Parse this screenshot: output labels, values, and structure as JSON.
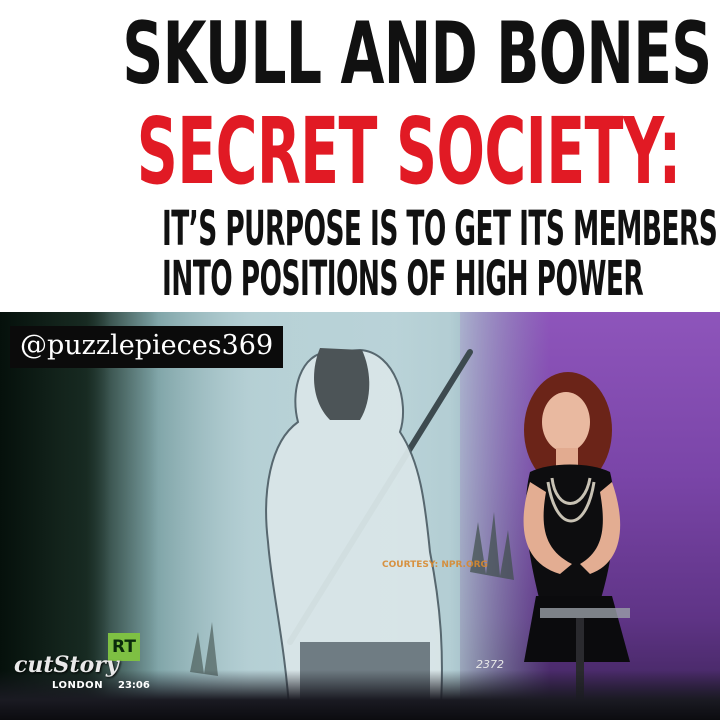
{
  "headline": {
    "line1": "SKULL AND BONES",
    "line2": "SECRET SOCIETY:",
    "line3": "IT’S PURPOSE IS TO GET ITS MEMBERS",
    "line4": "INTO POSITIONS OF HIGH POWER",
    "line1_color": "#111111",
    "line2_color": "#e11a24"
  },
  "video": {
    "handle": "@puzzlepieces369",
    "channel_logo": "RT",
    "show_logo": "cutStory",
    "location": "LONDON",
    "time": "23:06",
    "photo_credit": "COURTESY: NPR.ORG",
    "ticker_number": "2372",
    "logo_color": "#7ec043"
  }
}
